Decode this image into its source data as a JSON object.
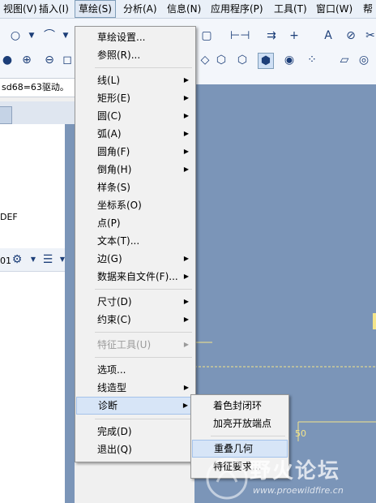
{
  "menubar": {
    "items": [
      {
        "label": "视图(V)"
      },
      {
        "label": "插入(I)"
      },
      {
        "label": "草绘(S)"
      },
      {
        "label": "分析(A)"
      },
      {
        "label": "信息(N)"
      },
      {
        "label": "应用程序(P)"
      },
      {
        "label": "工具(T)"
      },
      {
        "label": "窗口(W)"
      },
      {
        "label": "帮"
      }
    ]
  },
  "status_line": "sd68=63驱动。",
  "tree": {
    "text1": "DEF",
    "text2": "01"
  },
  "sketch_menu": {
    "items": [
      {
        "label": "草绘设置..."
      },
      {
        "label": "参照(R)..."
      },
      {
        "label": "线(L)"
      },
      {
        "label": "矩形(E)"
      },
      {
        "label": "圆(C)"
      },
      {
        "label": "弧(A)"
      },
      {
        "label": "圆角(F)"
      },
      {
        "label": "倒角(H)"
      },
      {
        "label": "样条(S)"
      },
      {
        "label": "坐标系(O)"
      },
      {
        "label": "点(P)"
      },
      {
        "label": "文本(T)..."
      },
      {
        "label": "边(G)"
      },
      {
        "label": "数据来自文件(F)..."
      },
      {
        "label": "尺寸(D)"
      },
      {
        "label": "约束(C)"
      },
      {
        "label": "特征工具(U)"
      },
      {
        "label": "选项..."
      },
      {
        "label": "线造型"
      },
      {
        "label": "诊断"
      },
      {
        "label": "完成(D)"
      },
      {
        "label": "退出(Q)"
      }
    ]
  },
  "diagnose_submenu": {
    "items": [
      {
        "label": "着色封闭环"
      },
      {
        "label": "加亮开放端点"
      },
      {
        "label": "重叠几何"
      },
      {
        "label": "特征要求..."
      }
    ]
  },
  "graphics": {
    "dim_label": "50"
  },
  "watermark": {
    "title": "野火论坛",
    "url": "www.proewildfire.cn"
  },
  "colors": {
    "graphics_bg": "#7b95b8",
    "highlight": "#d7e5f7",
    "sketch_yellow": "#f4e58a"
  }
}
